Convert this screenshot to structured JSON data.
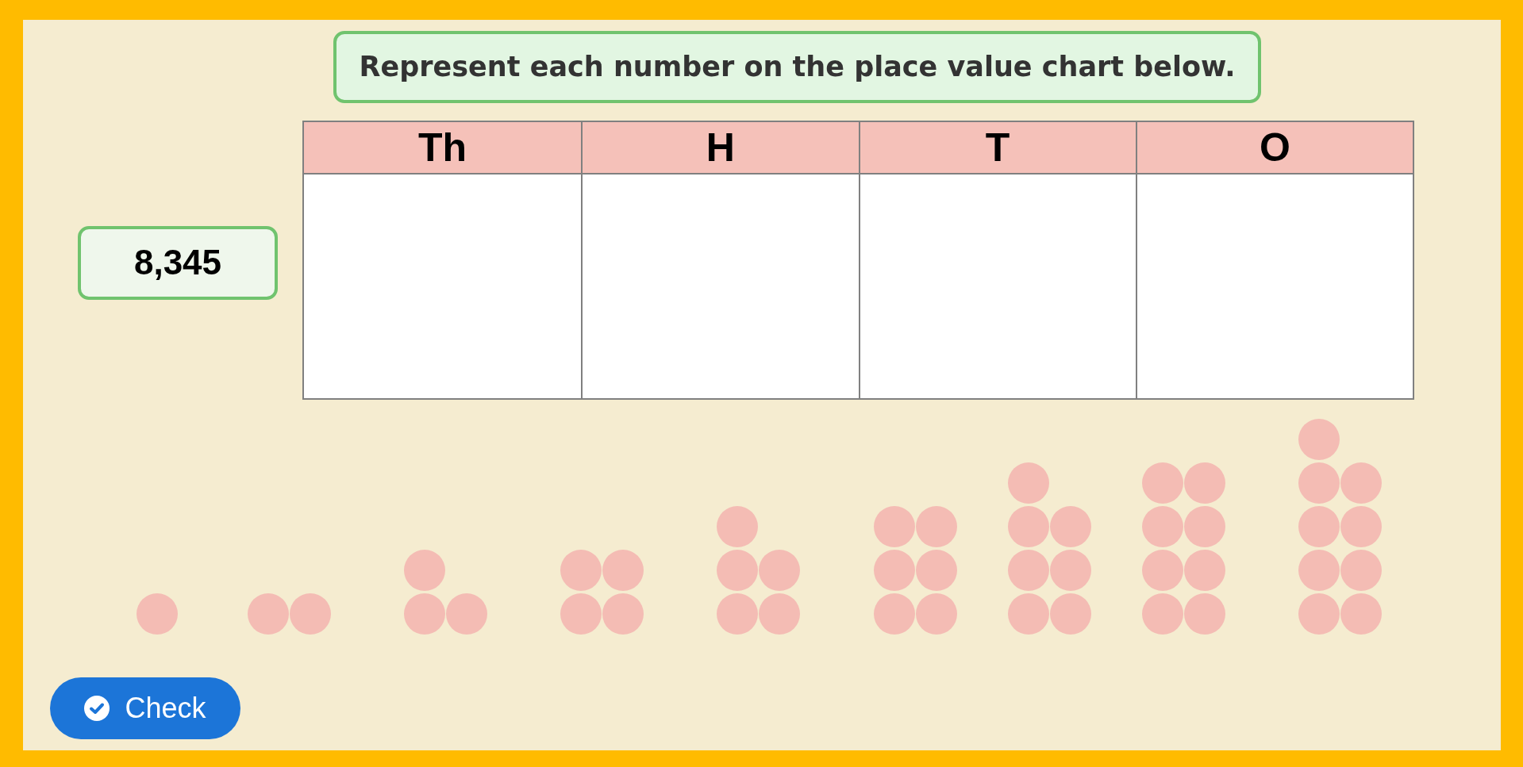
{
  "instruction": "Represent each number on the place value chart below.",
  "number_card": {
    "value": "8,345"
  },
  "place_value_chart": {
    "columns": [
      {
        "label": "Th"
      },
      {
        "label": "H"
      },
      {
        "label": "T"
      },
      {
        "label": "O"
      }
    ]
  },
  "counter_groups": [
    {
      "counters": [
        {
          "kind": "dot"
        }
      ]
    },
    {
      "counters": [
        {
          "kind": "dot"
        },
        {
          "kind": "dot"
        }
      ]
    },
    {
      "counters": [
        {
          "kind": "dot"
        },
        {
          "kind": "dot"
        },
        {
          "kind": "dot"
        }
      ]
    },
    {
      "counters": [
        {
          "kind": "dot"
        },
        {
          "kind": "dot"
        },
        {
          "kind": "dot"
        },
        {
          "kind": "dot"
        }
      ]
    },
    {
      "counters": [
        {
          "kind": "dot"
        },
        {
          "kind": "dot"
        },
        {
          "kind": "dot"
        },
        {
          "kind": "dot"
        },
        {
          "kind": "dot"
        }
      ]
    },
    {
      "counters": [
        {
          "kind": "dot"
        },
        {
          "kind": "dot"
        },
        {
          "kind": "dot"
        },
        {
          "kind": "dot"
        },
        {
          "kind": "dot"
        },
        {
          "kind": "dot"
        }
      ]
    },
    {
      "counters": [
        {
          "kind": "dot"
        },
        {
          "kind": "dot"
        },
        {
          "kind": "dot"
        },
        {
          "kind": "dot"
        },
        {
          "kind": "dot"
        },
        {
          "kind": "dot"
        },
        {
          "kind": "dot"
        }
      ]
    },
    {
      "counters": [
        {
          "kind": "dot"
        },
        {
          "kind": "dot"
        },
        {
          "kind": "dot"
        },
        {
          "kind": "dot"
        },
        {
          "kind": "dot"
        },
        {
          "kind": "dot"
        },
        {
          "kind": "dot"
        },
        {
          "kind": "dot"
        }
      ]
    },
    {
      "counters": [
        {
          "kind": "dot"
        },
        {
          "kind": "dot"
        },
        {
          "kind": "dot"
        },
        {
          "kind": "dot"
        },
        {
          "kind": "dot"
        },
        {
          "kind": "dot"
        },
        {
          "kind": "dot"
        },
        {
          "kind": "dot"
        },
        {
          "kind": "dot"
        }
      ]
    }
  ],
  "check_button": {
    "label": "Check"
  }
}
